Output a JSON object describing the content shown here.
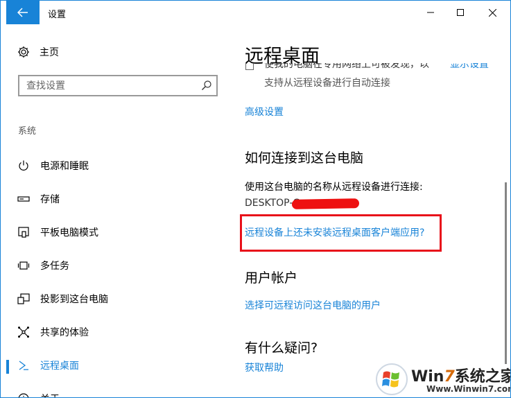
{
  "window": {
    "title": "设置"
  },
  "sidebar": {
    "home_label": "主页",
    "search_placeholder": "查找设置",
    "section_label": "系统",
    "items": [
      {
        "label": "电源和睡眠",
        "icon": "power-icon"
      },
      {
        "label": "存储",
        "icon": "storage-icon"
      },
      {
        "label": "平板电脑模式",
        "icon": "tablet-mode-icon"
      },
      {
        "label": "多任务",
        "icon": "multitasking-icon"
      },
      {
        "label": "投影到这台电脑",
        "icon": "project-icon"
      },
      {
        "label": "共享的体验",
        "icon": "shared-experiences-icon"
      },
      {
        "label": "远程桌面",
        "icon": "remote-desktop-icon",
        "active": true
      },
      {
        "label": "关于",
        "icon": "about-icon"
      }
    ]
  },
  "content": {
    "page_title": "远程桌面",
    "partial_row_text": "使我的电脑在专用网络上可被发现，以",
    "partial_row_link": "显示设置",
    "auto_connect_text": "支持从远程设备进行自动连接",
    "advanced_settings_link": "高级设置",
    "how_to_connect": {
      "heading": "如何连接到这台电脑",
      "description": "使用这台电脑的名称从远程设备进行连接:",
      "pc_name": "DESKTOP-C",
      "client_app_link": "远程设备上还未安装远程桌面客户端应用?"
    },
    "user_accounts": {
      "heading": "用户帐户",
      "link": "选择可远程访问这台电脑的用户"
    },
    "questions": {
      "heading": "有什么疑问?",
      "link": "获取帮助"
    }
  },
  "watermark": {
    "title_prefix": "Win",
    "title_digit": "7",
    "title_suffix": "系统之家",
    "url": "Www.Winwin7.com"
  },
  "colors": {
    "accent": "#1883d7",
    "highlight_border": "#e8101a"
  }
}
